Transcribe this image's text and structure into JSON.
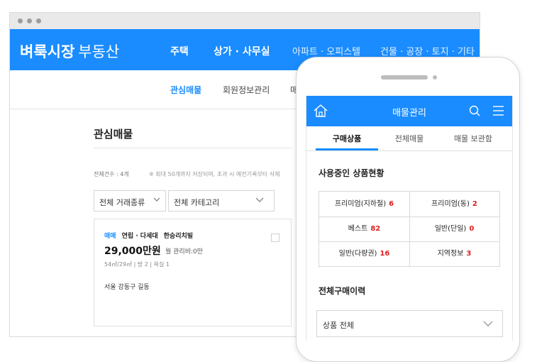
{
  "desktop": {
    "logo": {
      "bold": "벼룩시장",
      "normal": "부동산"
    },
    "nav": [
      "주택",
      "상가 · 사무실",
      "아파트 · 오피스텔",
      "건물 · 공장 · 토지 · 기타"
    ],
    "subnav": [
      "관심매물",
      "회원정보관리",
      "매"
    ],
    "page_title": "관심매물",
    "count_text": "전체건수 : 4개",
    "notice_text": "※ 최대 50개까지 저장되며, 초과 시 예전기록부터 삭제",
    "filters": [
      "전체 거래종류",
      "전체 카테고리"
    ],
    "listing": {
      "deal_type": "매매",
      "category": "연립 · 다세대",
      "name": "한승리치빌",
      "price": "29,000만원",
      "fee": "월 관리비:0만",
      "specs": "54㎡/29㎡  |  방 2  |  욕실 1",
      "address": "서울 강동구 길동"
    }
  },
  "mobile": {
    "title": "매물관리",
    "tabs": [
      "구매상품",
      "전체매물",
      "매물 보관함"
    ],
    "usage_title": "사용중인 상품현황",
    "products": [
      {
        "label": "프리미엄(지하철)",
        "count": "6"
      },
      {
        "label": "프리미엄(동)",
        "count": "2"
      },
      {
        "label": "베스트",
        "count": "82"
      },
      {
        "label": "일반(단일)",
        "count": "0"
      },
      {
        "label": "일반(다량권)",
        "count": "16"
      },
      {
        "label": "지역정보",
        "count": "3"
      }
    ],
    "history_title": "전체구매이력",
    "history_filter": "상품 전체"
  },
  "colors": {
    "brand": "#1a8cff",
    "count_red": "#e02020"
  }
}
